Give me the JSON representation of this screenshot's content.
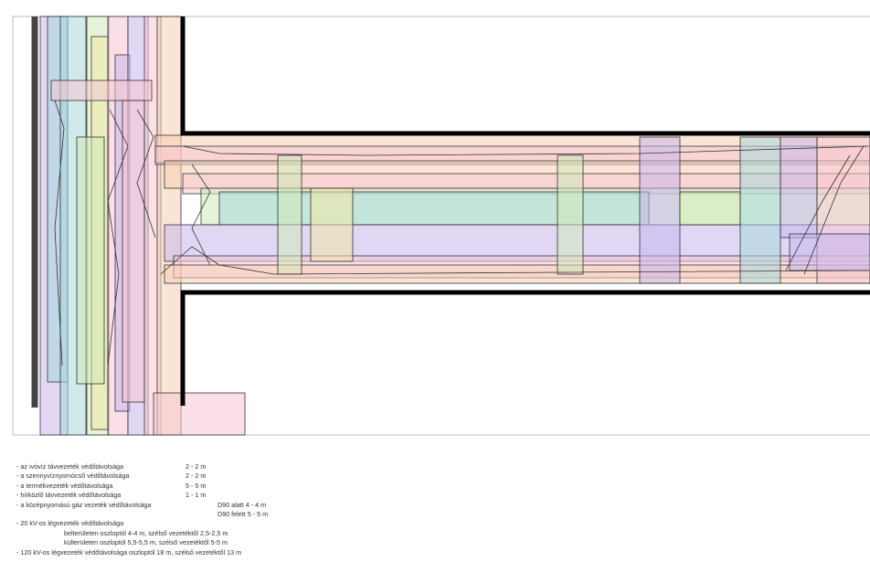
{
  "legend": {
    "items": [
      {
        "label": "- az ivóvíz távvezeték védőtávolsága",
        "value": "2 - 2  m"
      },
      {
        "label": "- a szennyvíznyomócső védőtávolsága",
        "value": "2 - 2 m"
      },
      {
        "label": "- a termékvezeték védőtávolsága",
        "value": "5 - 5 m"
      },
      {
        "label": "- hírközlő távvezeték védőtávolsága",
        "value": "1 - 1 m"
      }
    ],
    "gas": {
      "label": "- a középnyomású gáz vezeték védőtávolsága",
      "below": "D90 alatt  4 - 4 m",
      "above": "D90 felett 5 - 5 m"
    },
    "kv20": {
      "label": "- 20 kV-os légvezeték védőtávolsága",
      "inner": "belterületen oszloptól 4-4 m, szélső vezetéktől 2,5-2,5 m",
      "outer": "külterületen oszloptól 5,5-5,5 m, szélső vezetéktől 5-5 m"
    },
    "kv120": "- 120 kV-os légvezeték védőtávolsága oszloptól 18 m, szélső vezetéktől 13 m"
  },
  "zone_colors": {
    "blue": "#a9d8dc",
    "purple": "#c9b6ec",
    "pink": "#f6c6d2",
    "peach": "#f6cdb4",
    "green": "#cfe9b8",
    "yellow": "#f2e7a6"
  }
}
